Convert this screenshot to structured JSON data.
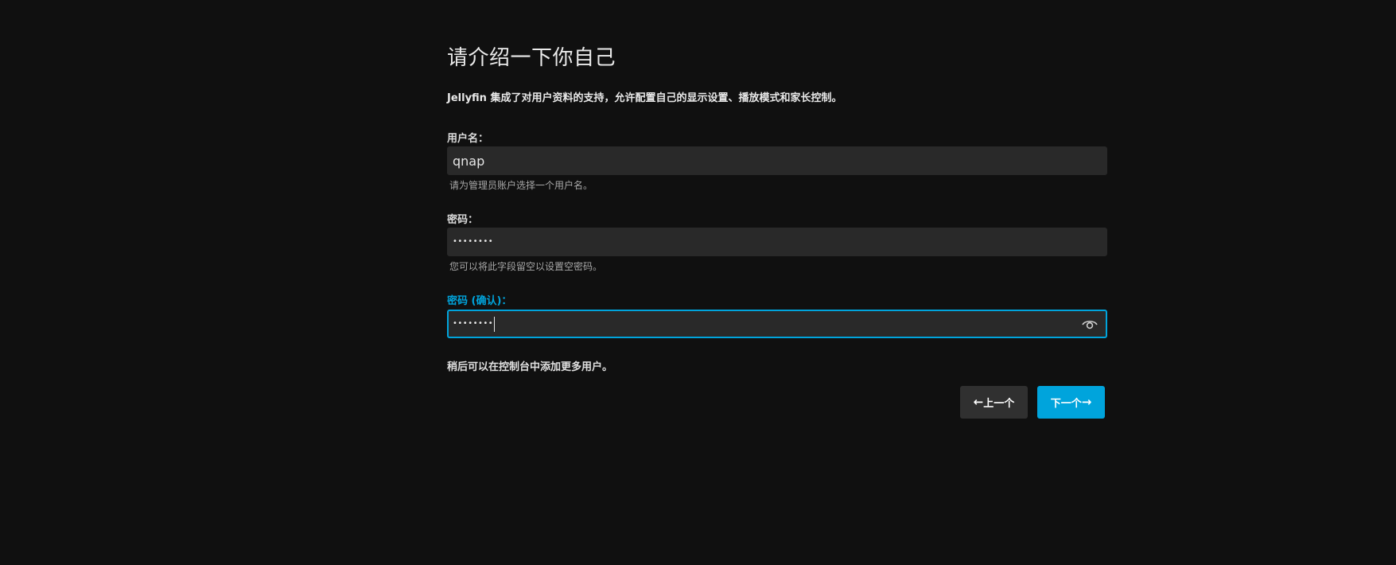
{
  "page": {
    "title": "请介绍一下你自己",
    "description": "Jellyfin 集成了对用户资料的支持，允许配置自己的显示设置、播放模式和家长控制。",
    "note": "稍后可以在控制台中添加更多用户。"
  },
  "fields": {
    "username": {
      "label": "用户名：",
      "value": "qnap",
      "hint": "请为管理员账户选择一个用户名。"
    },
    "password": {
      "label": "密码：",
      "value": "••••••••",
      "hint": "您可以将此字段留空以设置空密码。"
    },
    "password_confirm": {
      "label": "密码 (确认)：",
      "value": "••••••••",
      "show_password_icon": "eye-icon"
    }
  },
  "buttons": {
    "prev_label": "上一个",
    "prev_icon": "arrow-left-icon",
    "next_label": "下一个",
    "next_icon": "arrow-right-icon"
  },
  "colors": {
    "background": "#101010",
    "accent": "#00a4dc",
    "input_background": "#292929"
  }
}
